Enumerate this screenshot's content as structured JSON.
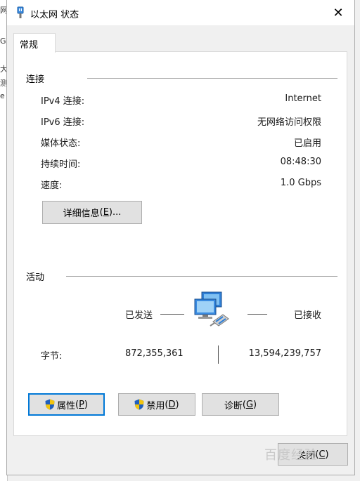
{
  "window": {
    "title": "以太网 状态",
    "close_symbol": "✕"
  },
  "background_window": {
    "fragments": [
      "网",
      "G",
      "大",
      "测",
      "e"
    ]
  },
  "tabs": [
    {
      "label": "常规",
      "selected": true
    }
  ],
  "connection": {
    "group_label": "连接",
    "rows": [
      {
        "label": "IPv4 连接:",
        "value": "Internet"
      },
      {
        "label": "IPv6 连接:",
        "value": "无网络访问权限"
      },
      {
        "label": "媒体状态:",
        "value": "已启用"
      },
      {
        "label": "持续时间:",
        "value": "08:48:30"
      },
      {
        "label": "速度:",
        "value": "1.0 Gbps"
      }
    ],
    "details_button": {
      "label": "详细信息",
      "accel": "E",
      "suffix": "..."
    }
  },
  "activity": {
    "group_label": "活动",
    "sent_label": "已发送",
    "received_label": "已接收",
    "bytes_label": "字节:",
    "bytes_sent": "872,355,361",
    "bytes_received": "13,594,239,757",
    "network_icon": "network-computers-icon"
  },
  "buttons": {
    "properties": {
      "label": "属性",
      "accel": "P",
      "icon": "shield-icon"
    },
    "disable": {
      "label": "禁用",
      "accel": "D",
      "icon": "shield-icon"
    },
    "diagnose": {
      "label": "诊断",
      "accel": "G"
    },
    "close": {
      "label": "关闭",
      "accel": "C"
    }
  },
  "watermark": "百度经验",
  "colors": {
    "focus_border": "#0078d7",
    "shield_blue": "#1f5fbf",
    "shield_yellow": "#f2c40f"
  }
}
